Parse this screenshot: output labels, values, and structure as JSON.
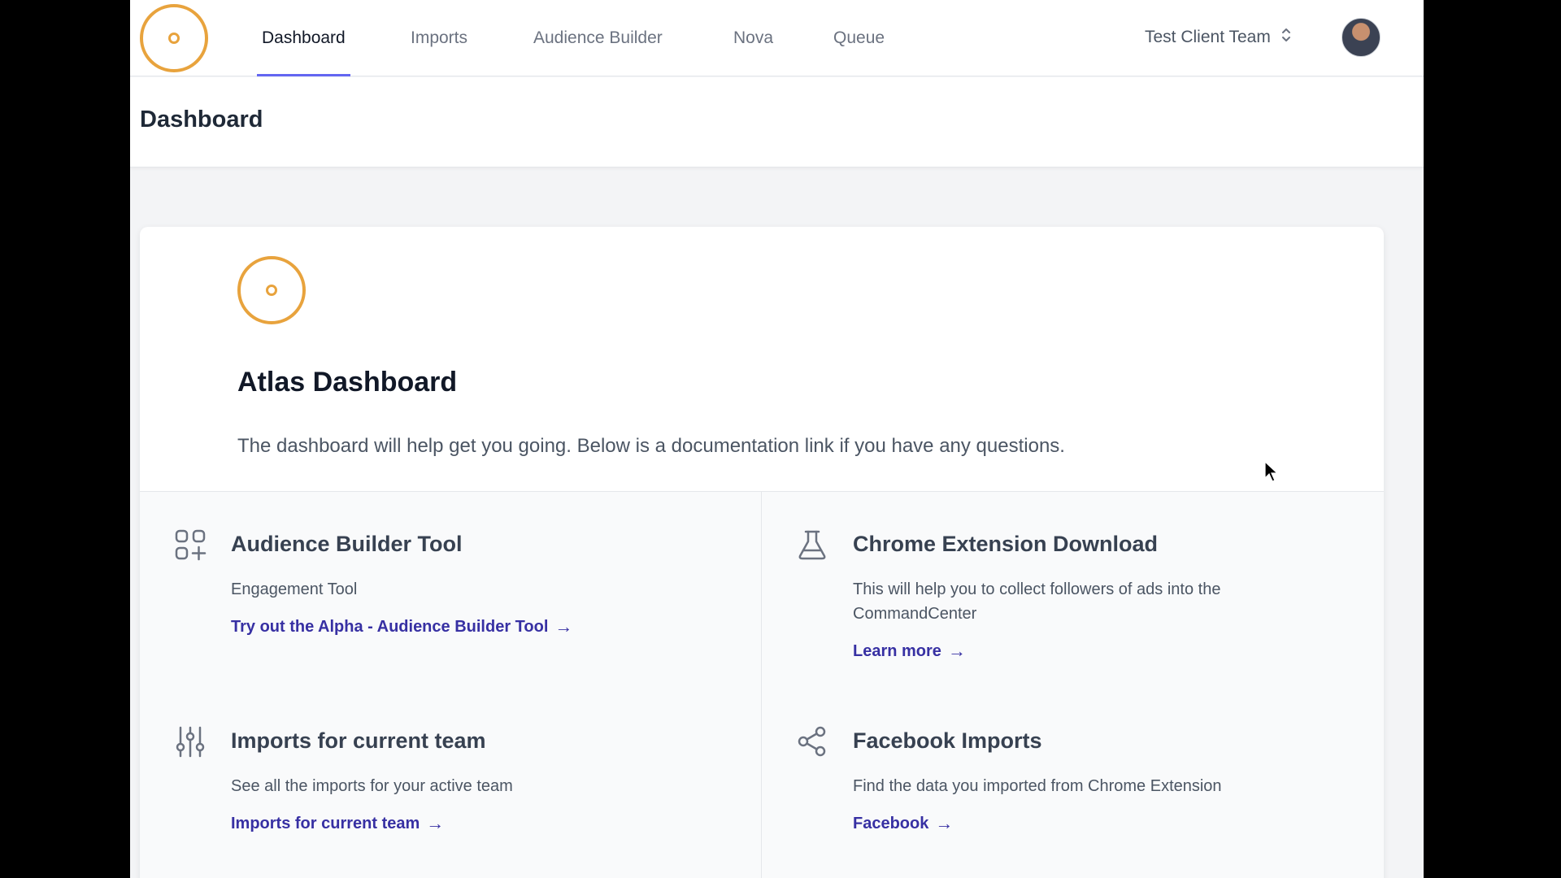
{
  "nav": {
    "tabs": [
      {
        "label": "Dashboard",
        "active": true
      },
      {
        "label": "Imports",
        "active": false
      },
      {
        "label": "Audience Builder",
        "active": false
      },
      {
        "label": "Nova",
        "active": false
      },
      {
        "label": "Queue",
        "active": false
      }
    ],
    "team_label": "Test Client Team",
    "team_icon": "chevron-up-down-icon",
    "logo_icon": "atlas-logo-icon"
  },
  "header": {
    "title": "Dashboard"
  },
  "card": {
    "title": "Atlas Dashboard",
    "description": "The dashboard will help get you going. Below is a documentation link if you have any questions.",
    "features": [
      {
        "icon": "grid-plus-icon",
        "title": "Audience Builder Tool",
        "description": "Engagement Tool",
        "link": "Try out the Alpha - Audience Builder Tool"
      },
      {
        "icon": "beaker-icon",
        "title": "Chrome Extension Download",
        "description": "This will help you to collect followers of ads into the CommandCenter",
        "link": "Learn more"
      },
      {
        "icon": "sliders-icon",
        "title": "Imports for current team",
        "description": "See all the imports for your active team",
        "link": "Imports for current team"
      },
      {
        "icon": "share-icon",
        "title": "Facebook Imports",
        "description": "Find the data you imported from Chrome Extension",
        "link": "Facebook"
      }
    ]
  },
  "colors": {
    "accent": "#6366f1",
    "link": "#3730a3",
    "logo": "#e8a33d"
  }
}
